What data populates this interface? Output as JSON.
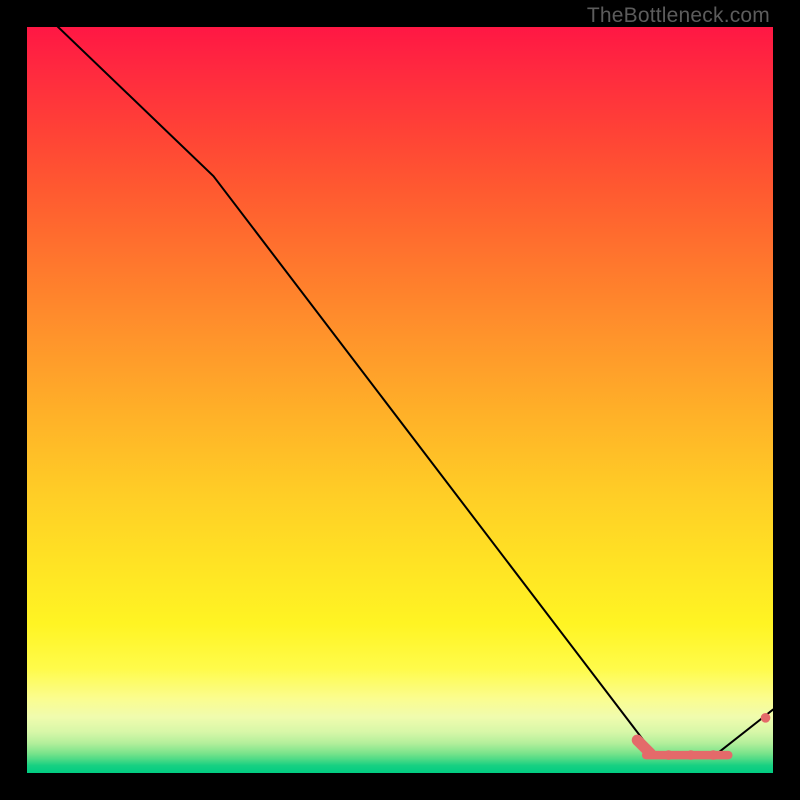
{
  "watermark": "TheBottleneck.com",
  "chart_data": {
    "type": "line",
    "title": "",
    "xlabel": "",
    "ylabel": "",
    "xlim": [
      0,
      100
    ],
    "ylim": [
      0,
      100
    ],
    "grid": false,
    "line_color": "#000000",
    "line_width": 2,
    "series": [
      {
        "name": "bottleneck-curve",
        "x": [
          0,
          25,
          84,
          92,
          100
        ],
        "y": [
          104,
          80,
          2.6,
          2.2,
          8.5
        ]
      }
    ],
    "flat_band": {
      "name": "flat-segment-highlight",
      "color": "#e46a6a",
      "dot_radius_px": 4.8,
      "x_start": 83,
      "x_end": 94,
      "y": 2.4,
      "end_dot_x": 99,
      "end_dot_y": 7.4
    },
    "background": {
      "type": "vertical-gradient",
      "stops": [
        {
          "pos": 0,
          "color": "#ff1744"
        },
        {
          "pos": 0.5,
          "color": "#ffb128"
        },
        {
          "pos": 0.8,
          "color": "#fff423"
        },
        {
          "pos": 1.0,
          "color": "#00cd82"
        }
      ]
    }
  }
}
